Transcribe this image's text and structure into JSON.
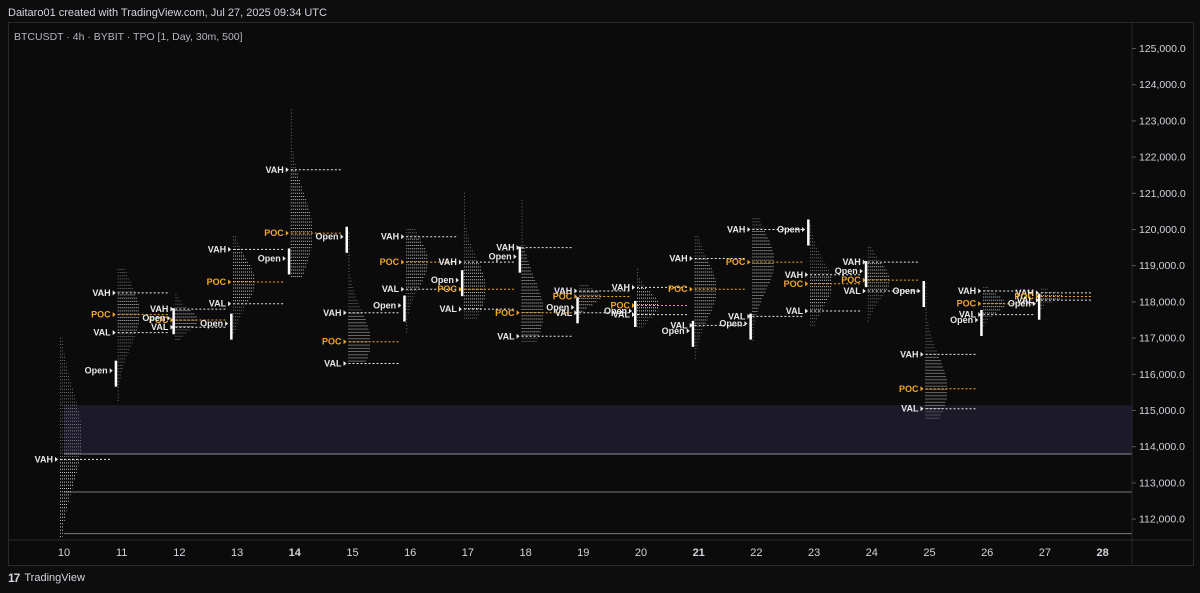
{
  "header": {
    "attribution": "Daitaro01 created with TradingView.com, Jul 27, 2025 09:34 UTC"
  },
  "symbol_line": "BTCUSDT · 4h · BYBIT · TPO [1, Day, 30m, 500]",
  "footer": {
    "brand": "TradingView",
    "logo_text": "17"
  },
  "colors": {
    "background": "#0b0b0b",
    "tpo": "#e6e6e6",
    "poc": "#f5a623",
    "zone": "#1c1a29",
    "text": "#d1d4dc"
  },
  "chart_data": {
    "type": "tpo",
    "title": "",
    "x": [
      "10",
      "11",
      "12",
      "13",
      "14",
      "15",
      "16",
      "17",
      "18",
      "19",
      "20",
      "21",
      "22",
      "23",
      "24",
      "25",
      "26",
      "27",
      "28"
    ],
    "y_ticks": [
      "125,000.0",
      "124,000.0",
      "123,000.0",
      "122,000.0",
      "121,000.0",
      "120,000.0",
      "119,000.0",
      "118,000.0",
      "117,000.0",
      "116,000.0",
      "115,000.0",
      "114,000.0",
      "113,000.0",
      "112,000.0"
    ],
    "ylim": [
      111500,
      125500
    ],
    "highlight_zone": [
      113800,
      115150
    ],
    "horizontal_lines": [
      112750,
      111600
    ],
    "markers": [
      "VAH",
      "POC",
      "VAL",
      "Open"
    ],
    "profiles": [
      {
        "day": "10",
        "low": 111500,
        "high": 117000,
        "vah": 113650,
        "poc": null,
        "val": null,
        "open": null
      },
      {
        "day": "11",
        "low": 115200,
        "high": 118900,
        "vah": 118250,
        "poc": 117650,
        "val": 117150,
        "open": 116100
      },
      {
        "day": "12",
        "low": 116900,
        "high": 118200,
        "vah": 117800,
        "poc": 117500,
        "val": 117300,
        "open": 117550
      },
      {
        "day": "13",
        "low": 117100,
        "high": 119800,
        "vah": 119450,
        "poc": 118550,
        "val": 117950,
        "open": 117400
      },
      {
        "day": "14",
        "low": 118700,
        "high": 123300,
        "vah": 121650,
        "poc": 119900,
        "val": null,
        "open": 119200
      },
      {
        "day": "15",
        "low": 116300,
        "high": 119900,
        "vah": 117700,
        "poc": 116900,
        "val": 116300,
        "open": 119800
      },
      {
        "day": "16",
        "low": 117100,
        "high": 120000,
        "vah": 119800,
        "poc": 119100,
        "val": 118350,
        "open": 117900
      },
      {
        "day": "17",
        "low": 117500,
        "high": 121000,
        "vah": 119100,
        "poc": 118350,
        "val": 117800,
        "open": 118600
      },
      {
        "day": "18",
        "low": 116900,
        "high": 120800,
        "vah": 119500,
        "poc": 117700,
        "val": 117050,
        "open": 119250
      },
      {
        "day": "19",
        "low": 117500,
        "high": 118450,
        "vah": 118300,
        "poc": 118150,
        "val": 117700,
        "open": 117850
      },
      {
        "day": "20",
        "low": 117300,
        "high": 118900,
        "vah": 118400,
        "poc": 117900,
        "val": 117650,
        "open": 117750
      },
      {
        "day": "21",
        "low": 116400,
        "high": 119800,
        "vah": 119200,
        "poc": 118350,
        "val": 117350,
        "open": 117200
      },
      {
        "day": "22",
        "low": 116900,
        "high": 120300,
        "vah": 120000,
        "poc": 119100,
        "val": 117600,
        "open": 117400
      },
      {
        "day": "23",
        "low": 117300,
        "high": 120100,
        "vah": 118750,
        "poc": 118500,
        "val": 117750,
        "open": 120000
      },
      {
        "day": "24",
        "low": 117400,
        "high": 119500,
        "vah": 119100,
        "poc": 118600,
        "val": 118300,
        "open": 118850
      },
      {
        "day": "25",
        "low": 114700,
        "high": 118500,
        "vah": 116550,
        "poc": 115600,
        "val": 115050,
        "open": 118300
      },
      {
        "day": "26",
        "low": 117300,
        "high": 118400,
        "vah": 118300,
        "poc": 117950,
        "val": 117650,
        "open": 117500
      },
      {
        "day": "27",
        "low": 117800,
        "high": 118350,
        "vah": 118250,
        "poc": 118150,
        "val": 118050,
        "open": 117950
      }
    ]
  }
}
